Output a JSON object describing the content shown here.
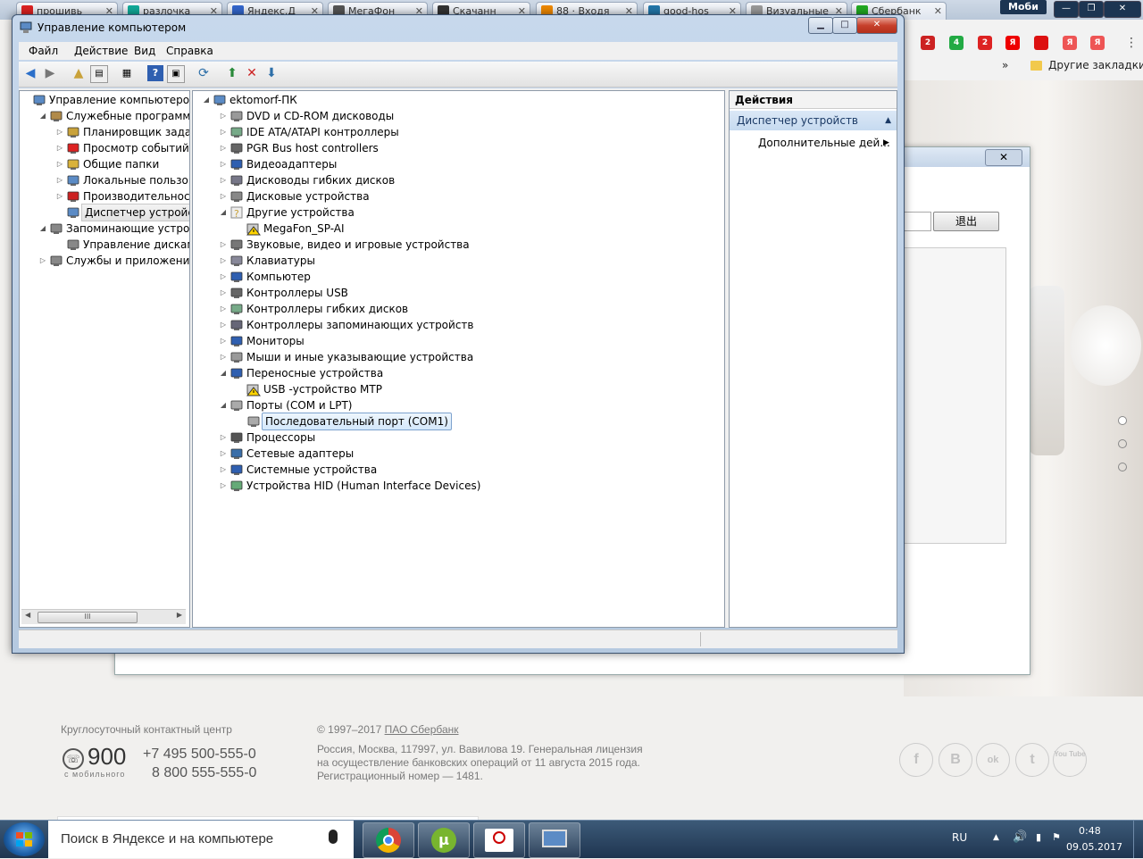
{
  "browser": {
    "tabs": [
      {
        "label": "прошивь",
        "fav": "#d22"
      },
      {
        "label": "разлочка",
        "fav": "#1a9"
      },
      {
        "label": "Яндекс.Д",
        "fav": "#36c"
      },
      {
        "label": "МегаФон",
        "fav": "#555"
      },
      {
        "label": "Скачанн",
        "fav": "#333"
      },
      {
        "label": "88 · Входя",
        "fav": "#e80"
      },
      {
        "label": "good-hos",
        "fav": "#27a"
      },
      {
        "label": "Визуальные",
        "fav": "#999"
      },
      {
        "label": "Сбербанк",
        "fav": "#2a2"
      }
    ],
    "profile_label": "Моби",
    "bookmarks_label": "Другие закладки",
    "bookmarks_chevron": "»",
    "extensions": [
      {
        "badge": "2",
        "color": "#c22"
      },
      {
        "badge": "4",
        "color": "#2a4"
      },
      {
        "badge": "2",
        "color": "#d22"
      },
      {
        "badge": "Я",
        "color": "#e00"
      },
      {
        "badge": "",
        "color": "#d11"
      },
      {
        "badge": "Я",
        "color": "#e55"
      },
      {
        "badge": "Я",
        "color": "#e55"
      }
    ]
  },
  "site": {
    "exit_label": "退出",
    "close_symbol": "✕",
    "footer": {
      "contact_title": "Круглосуточный контактный центр",
      "short_number": "900",
      "short_number_caption": "с мобильного",
      "phone_1": "+7 495 500-555-0",
      "phone_2": "8 800 555-555-0",
      "copyright_prefix": "© 1997–2017 ",
      "copyright_link": "ПАО Сбербанк",
      "address_1": "Россия, Москва, 117997, ул. Вавилова 19. Генеральная лицензия",
      "address_2": "на осуществление банковских операций от 11 августа 2015 года.",
      "address_3": "Регистрационный номер — 1481.",
      "social": [
        "f",
        "B",
        "ok",
        "t",
        "You Tube"
      ]
    }
  },
  "mmc": {
    "title": "Управление компьютером",
    "menu": [
      "Файл",
      "Действие",
      "Вид",
      "Справка"
    ],
    "left_tree": [
      {
        "label": "Управление компьютером (л",
        "level": 0,
        "expander": "",
        "icon": "computer-management"
      },
      {
        "label": "Служебные программы",
        "level": 1,
        "expander": "open",
        "icon": "tools"
      },
      {
        "label": "Планировщик заданий",
        "level": 2,
        "expander": "closed",
        "icon": "clock"
      },
      {
        "label": "Просмотр событий",
        "level": 2,
        "expander": "closed",
        "icon": "event-viewer"
      },
      {
        "label": "Общие папки",
        "level": 2,
        "expander": "closed",
        "icon": "shared-folder"
      },
      {
        "label": "Локальные пользовате",
        "level": 2,
        "expander": "closed",
        "icon": "users"
      },
      {
        "label": "Производительность",
        "level": 2,
        "expander": "closed",
        "icon": "performance"
      },
      {
        "label": "Диспетчер устройств",
        "level": 2,
        "expander": "",
        "icon": "device-manager",
        "selected": true
      },
      {
        "label": "Запоминающие устройст",
        "level": 1,
        "expander": "open",
        "icon": "storage"
      },
      {
        "label": "Управление дисками",
        "level": 2,
        "expander": "",
        "icon": "disk"
      },
      {
        "label": "Службы и приложения",
        "level": 1,
        "expander": "closed",
        "icon": "services"
      }
    ],
    "device_tree": [
      {
        "label": "ektomorf-ПК",
        "level": 0,
        "expander": "open",
        "icon": "computer"
      },
      {
        "label": "DVD и CD-ROM дисководы",
        "level": 1,
        "expander": "closed",
        "icon": "dvd"
      },
      {
        "label": "IDE ATA/ATAPI контроллеры",
        "level": 1,
        "expander": "closed",
        "icon": "ide"
      },
      {
        "label": "PGR Bus host controllers",
        "level": 1,
        "expander": "closed",
        "icon": "usb"
      },
      {
        "label": "Видеоадаптеры",
        "level": 1,
        "expander": "closed",
        "icon": "display"
      },
      {
        "label": "Дисководы гибких дисков",
        "level": 1,
        "expander": "closed",
        "icon": "floppy"
      },
      {
        "label": "Дисковые устройства",
        "level": 1,
        "expander": "closed",
        "icon": "disk"
      },
      {
        "label": "Другие устройства",
        "level": 1,
        "expander": "open",
        "icon": "unknown"
      },
      {
        "label": "MegaFon_SP-AI",
        "level": 2,
        "expander": "",
        "icon": "warning"
      },
      {
        "label": "Звуковые, видео и игровые устройства",
        "level": 1,
        "expander": "closed",
        "icon": "speaker"
      },
      {
        "label": "Клавиатуры",
        "level": 1,
        "expander": "closed",
        "icon": "keyboard"
      },
      {
        "label": "Компьютер",
        "level": 1,
        "expander": "closed",
        "icon": "display"
      },
      {
        "label": "Контроллеры USB",
        "level": 1,
        "expander": "closed",
        "icon": "usb"
      },
      {
        "label": "Контроллеры гибких дисков",
        "level": 1,
        "expander": "closed",
        "icon": "ide"
      },
      {
        "label": "Контроллеры запоминающих устройств",
        "level": 1,
        "expander": "closed",
        "icon": "storage-ctrl"
      },
      {
        "label": "Мониторы",
        "level": 1,
        "expander": "closed",
        "icon": "display"
      },
      {
        "label": "Мыши и иные указывающие устройства",
        "level": 1,
        "expander": "closed",
        "icon": "mouse"
      },
      {
        "label": "Переносные устройства",
        "level": 1,
        "expander": "open",
        "icon": "display"
      },
      {
        "label": "USB -устройство MTP",
        "level": 2,
        "expander": "",
        "icon": "warning"
      },
      {
        "label": "Порты (COM и LPT)",
        "level": 1,
        "expander": "open",
        "icon": "port"
      },
      {
        "label": "Последовательный порт (COM1)",
        "level": 2,
        "expander": "",
        "icon": "port",
        "selected": true
      },
      {
        "label": "Процессоры",
        "level": 1,
        "expander": "closed",
        "icon": "cpu"
      },
      {
        "label": "Сетевые адаптеры",
        "level": 1,
        "expander": "closed",
        "icon": "network"
      },
      {
        "label": "Системные устройства",
        "level": 1,
        "expander": "closed",
        "icon": "display"
      },
      {
        "label": "Устройства HID (Human Interface Devices)",
        "level": 1,
        "expander": "closed",
        "icon": "hid"
      }
    ],
    "actions": {
      "header": "Действия",
      "section": "Диспетчер устройств",
      "more": "Дополнительные дей..."
    },
    "scroll_thumb": "III"
  },
  "taskbar": {
    "search_placeholder": "Поиск в Яндексе и на компьютере",
    "language": "RU",
    "time": "0:48",
    "date": "09.05.2017",
    "apps": [
      "chrome",
      "utorrent",
      "broadcom",
      "device-manager"
    ]
  },
  "colors": {
    "selection": "#d4e8fb",
    "title_bar": "#c7d8ec",
    "taskbar": "#1f3550"
  }
}
